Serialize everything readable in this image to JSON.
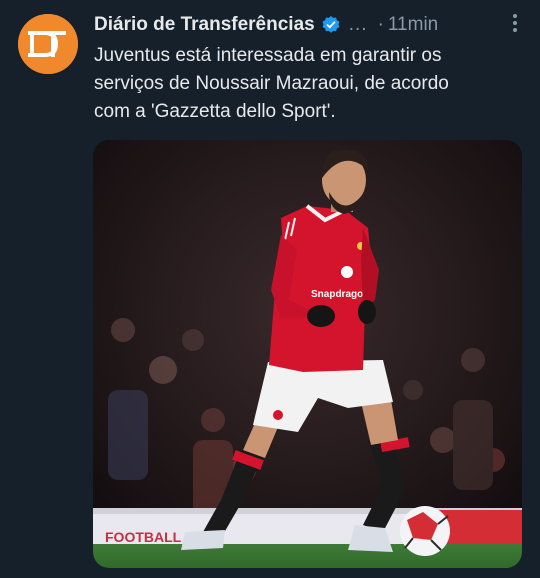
{
  "account": {
    "name": "Diário de Transferências",
    "time": "11min",
    "ellipsis": "...",
    "separator": "·",
    "avatar_text": "DT"
  },
  "tweet": {
    "text_line1": "Juventus está interessada em garantir os",
    "text_line2": "serviços de Noussair Mazraoui, de acordo",
    "text_line3": "com a 'Gazzetta dello Sport'."
  },
  "photo": {
    "shirt_sponsor": "Snapdragon",
    "board_text": "FOOTBALL"
  },
  "icons": {
    "verified": "verified-badge-icon",
    "more": "more-dots-icon"
  },
  "colors": {
    "background": "#15202b",
    "accent": "#1d9bf0",
    "avatar": "#f0892b",
    "kit_red": "#d4142d"
  }
}
